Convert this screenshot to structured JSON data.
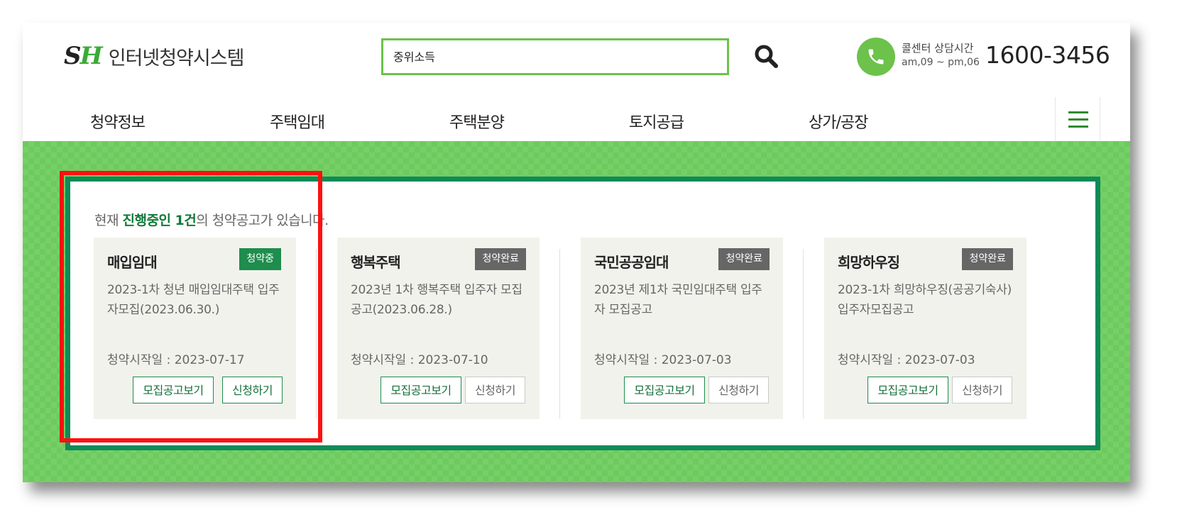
{
  "header": {
    "logo_mark_s": "S",
    "logo_mark_h": "H",
    "logo_text": "인터넷청약시스템",
    "search_value": "중위소득",
    "call_label": "콜센터 상담시간",
    "call_hours": "am,09 ~ pm,06",
    "call_number": "1600-3456"
  },
  "nav": {
    "items": [
      "청약정보",
      "주택임대",
      "주택분양",
      "토지공급",
      "상가/공장"
    ]
  },
  "status": {
    "prefix": "현재 ",
    "highlight": "진행중인 1건",
    "suffix": "의 청약공고가 있습니다."
  },
  "cards": [
    {
      "title": "매입임대",
      "badge": "청약중",
      "desc": "2023-1차 청년 매입임대주택 입주자모집(2023.06.30.)",
      "date": "청약시작일 : 2023-07-17",
      "view_label": "모집공고보기",
      "apply_label": "신청하기"
    },
    {
      "title": "행복주택",
      "badge": "청약완료",
      "desc": "2023년 1차 행복주택 입주자 모집 공고(2023.06.28.)",
      "date": "청약시작일 : 2023-07-10",
      "view_label": "모집공고보기",
      "apply_label": "신청하기"
    },
    {
      "title": "국민공공임대",
      "badge": "청약완료",
      "desc": "2023년 제1차 국민임대주택 입주자 모집공고",
      "date": "청약시작일 : 2023-07-03",
      "view_label": "모집공고보기",
      "apply_label": "신청하기"
    },
    {
      "title": "희망하우징",
      "badge": "청약완료",
      "desc": "2023-1차 희망하우징(공공기숙사) 입주자모집공고",
      "date": "청약시작일 : 2023-07-03",
      "view_label": "모집공고보기",
      "apply_label": "신청하기"
    }
  ],
  "colors": {
    "brand_green": "#6cc24a",
    "panel_border": "#0f8b59",
    "active_badge": "#1e8d4d",
    "closed_badge": "#666666",
    "highlight_box": "#ff1010"
  }
}
